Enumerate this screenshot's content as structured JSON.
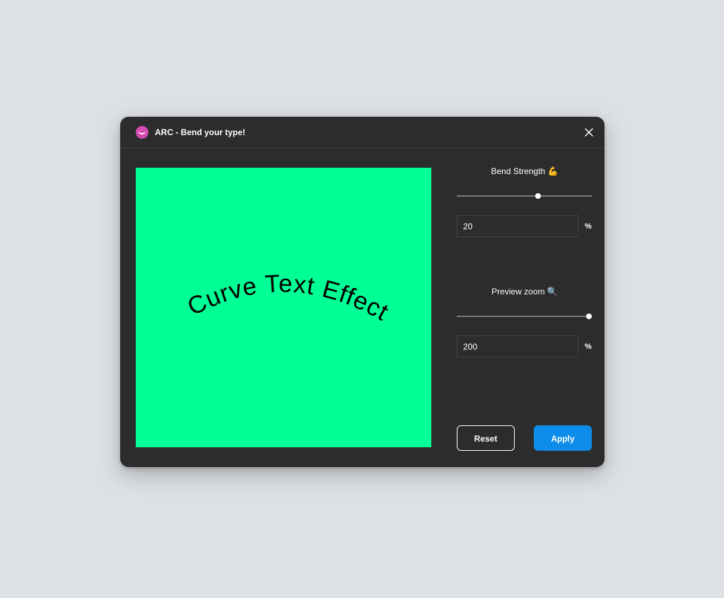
{
  "window": {
    "title": "ARC - Bend your type!"
  },
  "preview": {
    "text": "Curve Text Effect",
    "background_color": "#00ff95",
    "text_color": "#000000"
  },
  "bend_strength": {
    "label": "Bend Strength 💪",
    "value": "20",
    "unit": "%",
    "slider_fraction": 0.6
  },
  "preview_zoom": {
    "label": "Preview zoom 🔍",
    "value": "200",
    "unit": "%",
    "slider_fraction": 1.0
  },
  "buttons": {
    "reset": "Reset",
    "apply": "Apply"
  },
  "colors": {
    "window_bg": "#2c2c2c",
    "accent": "#0d8ce9",
    "app_icon": "#d44bb3"
  },
  "icons": {
    "app": "arc-logo-icon",
    "close": "close-icon"
  }
}
